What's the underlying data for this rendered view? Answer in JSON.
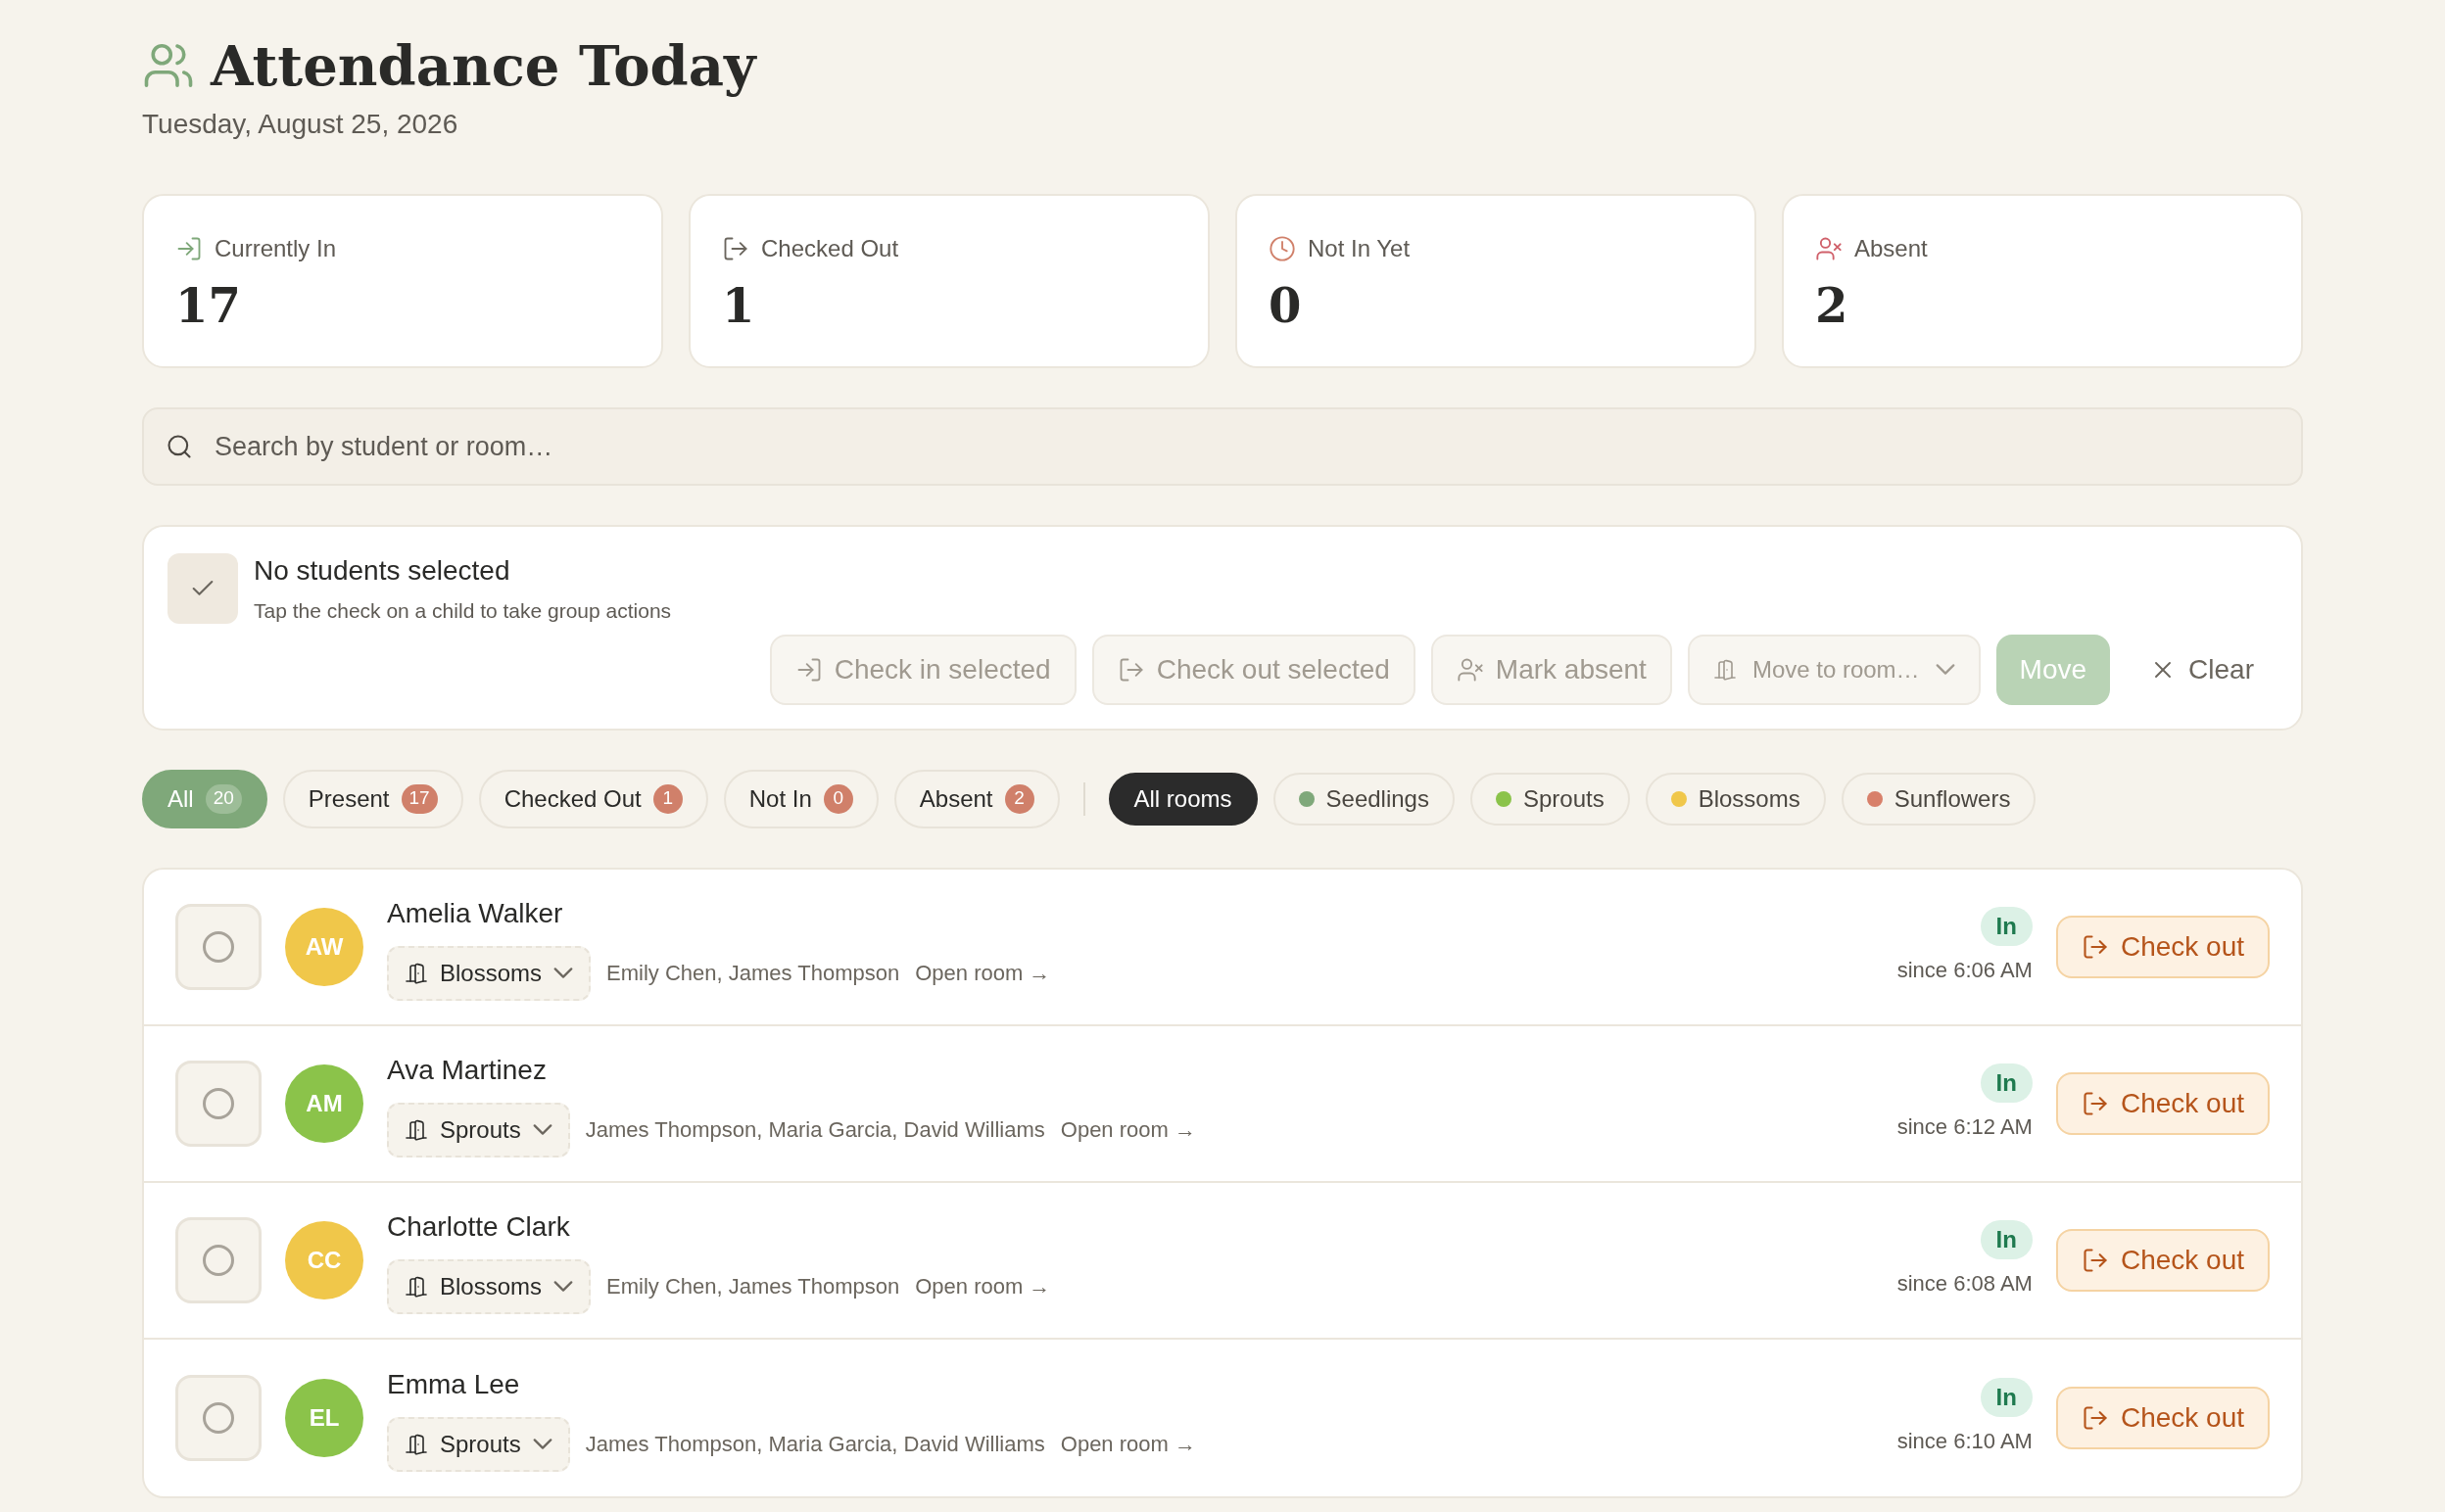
{
  "header": {
    "title": "Attendance Today",
    "date": "Tuesday, August 25, 2026"
  },
  "stats": [
    {
      "kind": "in",
      "label": "Currently In",
      "value": "17"
    },
    {
      "kind": "out",
      "label": "Checked Out",
      "value": "1"
    },
    {
      "kind": "pending",
      "label": "Not In Yet",
      "value": "0"
    },
    {
      "kind": "absent",
      "label": "Absent",
      "value": "2"
    }
  ],
  "search": {
    "placeholder": "Search by student or room…"
  },
  "bulk": {
    "title": "No students selected",
    "hint": "Tap the check on a child to take group actions",
    "disabled": true,
    "checked": false,
    "actions": [
      {
        "kind": "check_in",
        "label": "Check in selected"
      },
      {
        "kind": "check_out",
        "label": "Check out selected"
      },
      {
        "kind": "absent",
        "label": "Mark absent"
      }
    ],
    "room_select": {
      "placeholder": "Move to room…"
    },
    "move": "Move",
    "clear": "Clear"
  },
  "status_filters": [
    {
      "label": "All",
      "count": "20",
      "selected": true
    },
    {
      "label": "Present",
      "count": "17",
      "selected": false
    },
    {
      "label": "Checked Out",
      "count": "1",
      "selected": false
    },
    {
      "label": "Not In",
      "count": "0",
      "selected": false
    },
    {
      "label": "Absent",
      "count": "2",
      "selected": false
    }
  ],
  "room_filters": [
    {
      "label": "All rooms",
      "selected": true
    },
    {
      "label": "Seedlings",
      "color": "#7fa87a",
      "selected": false
    },
    {
      "label": "Sprouts",
      "color": "#8bc34a",
      "selected": false
    },
    {
      "label": "Blossoms",
      "color": "#f0c74a",
      "selected": false
    },
    {
      "label": "Sunflowers",
      "color": "#d8806a",
      "selected": false
    }
  ],
  "students": [
    {
      "initials": "AW",
      "name": "Amelia Walker",
      "color": "#f0c74a",
      "room": "Blossoms",
      "teachers": "Emily Chen, James Thompson",
      "link": "Open room →",
      "status": "In",
      "since": "since 6:06 AM",
      "action": "Check out",
      "selected": false
    },
    {
      "initials": "AM",
      "name": "Ava Martinez",
      "color": "#8bc34a",
      "room": "Sprouts",
      "teachers": "James Thompson, Maria Garcia, David Williams",
      "link": "Open room →",
      "status": "In",
      "since": "since 6:12 AM",
      "action": "Check out",
      "selected": false
    },
    {
      "initials": "CC",
      "name": "Charlotte Clark",
      "color": "#f0c74a",
      "room": "Blossoms",
      "teachers": "Emily Chen, James Thompson",
      "link": "Open room →",
      "status": "In",
      "since": "since 6:08 AM",
      "action": "Check out",
      "selected": false
    },
    {
      "initials": "EL",
      "name": "Emma Lee",
      "color": "#8bc34a",
      "room": "Sprouts",
      "teachers": "James Thompson, Maria Garcia, David Williams",
      "link": "Open room →",
      "status": "In",
      "since": "since 6:10 AM",
      "action": "Check out",
      "selected": false
    }
  ]
}
